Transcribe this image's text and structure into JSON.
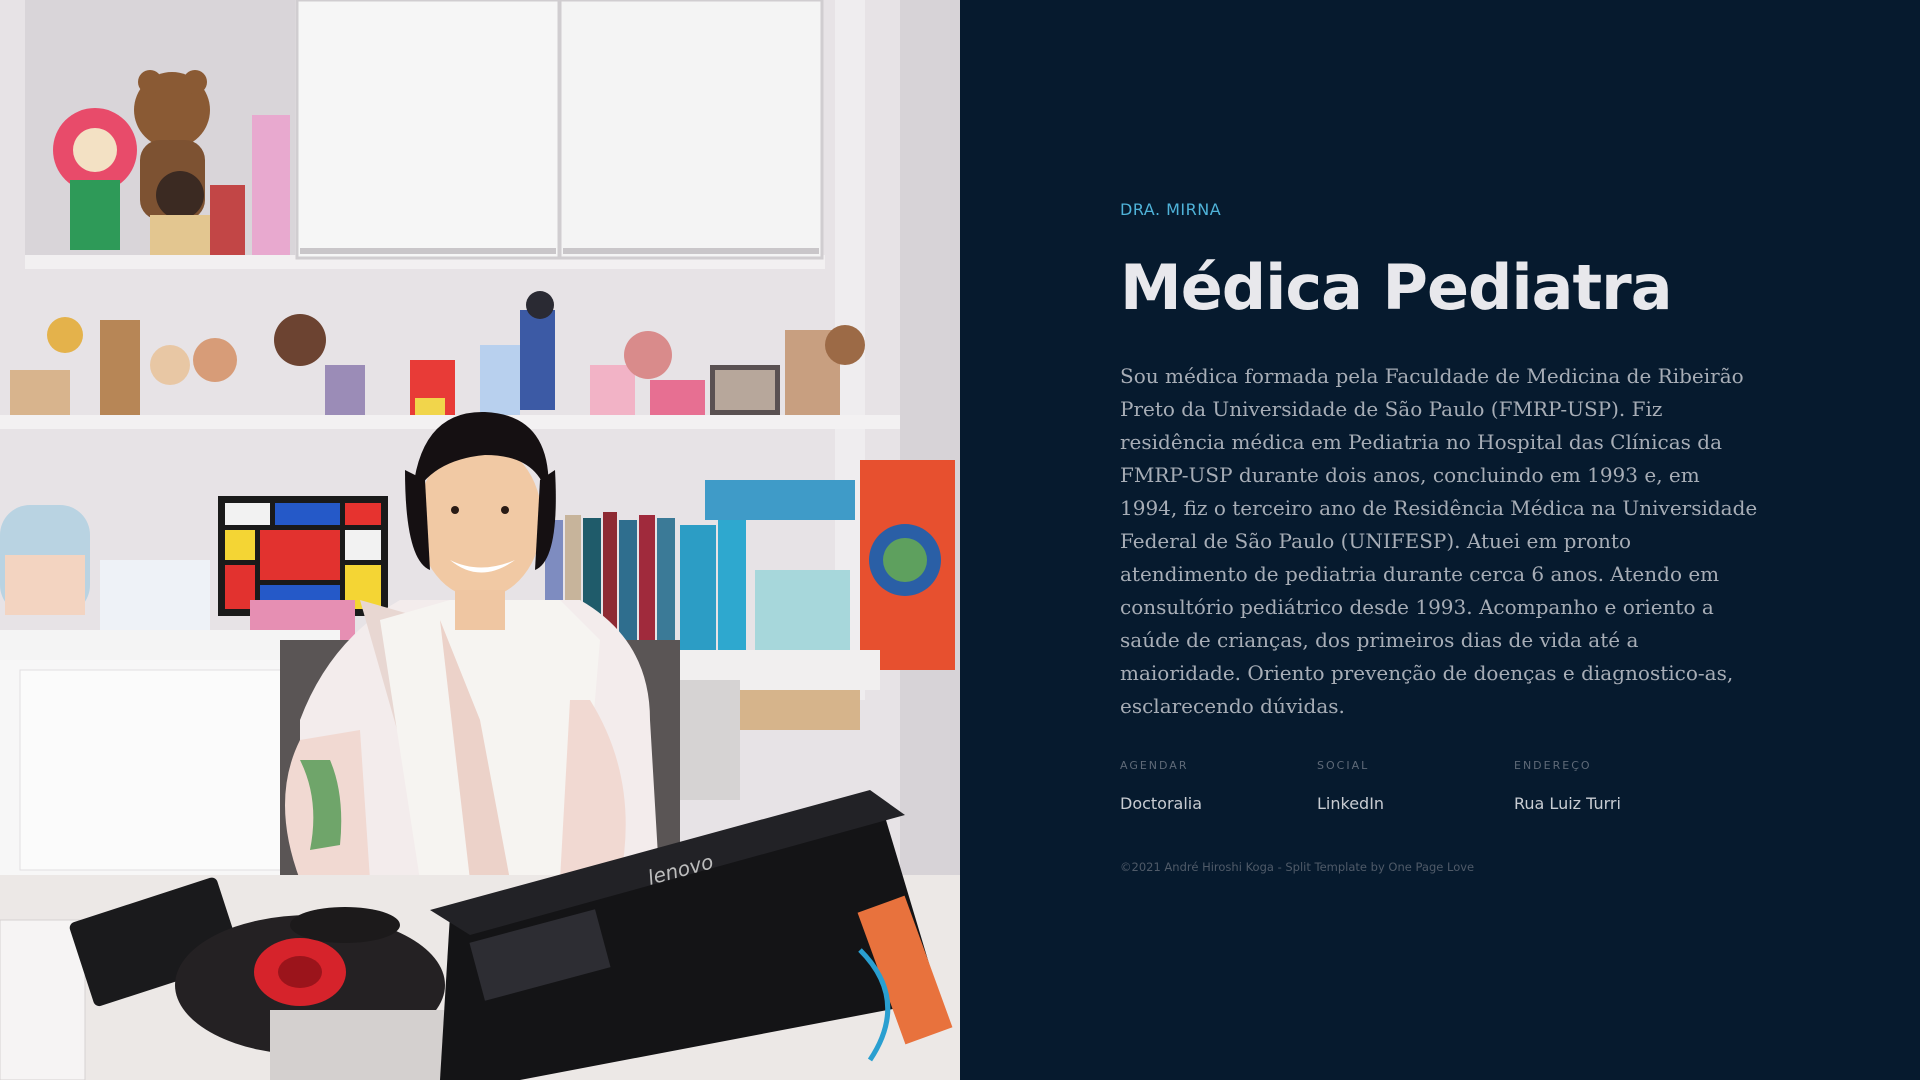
{
  "hero": {
    "kicker": "DRA. MIRNA",
    "title": "Médica Pediatra",
    "bio": "Sou médica formada pela Faculdade de Medicina de Ribeirão Preto da Universidade de São Paulo (FMRP-USP). Fiz residência médica em Pediatria no Hospital das Clínicas da FMRP-USP durante dois anos, concluindo em 1993 e, em 1994, fiz o terceiro ano de Residência Médica na Universidade Federal de São Paulo (UNIFESP). Atuei em pronto atendimento de pediatria durante cerca 6 anos. Atendo em consultório pediátrico desde 1993. Acompanho e oriento a saúde de crianças, dos primeiros dias de vida até a maioridade. Oriento prevenção de doenças e diagnostico-as, esclarecendo dúvidas."
  },
  "info": [
    {
      "heading": "AGENDAR",
      "link": "Doctoralia"
    },
    {
      "heading": "SOCIAL",
      "link": "LinkedIn"
    },
    {
      "heading": "ENDEREÇO",
      "link": "Rua Luiz Turri"
    }
  ],
  "footer": {
    "credit": "©2021 André Hiroshi Koga - Split Template by One Page Love"
  },
  "photo": {
    "laptop_brand": "lenovo"
  },
  "colors": {
    "background": "#061a2e",
    "accent": "#4fb3d9",
    "title": "#e8e8ec",
    "body_text": "#a7adb6"
  }
}
